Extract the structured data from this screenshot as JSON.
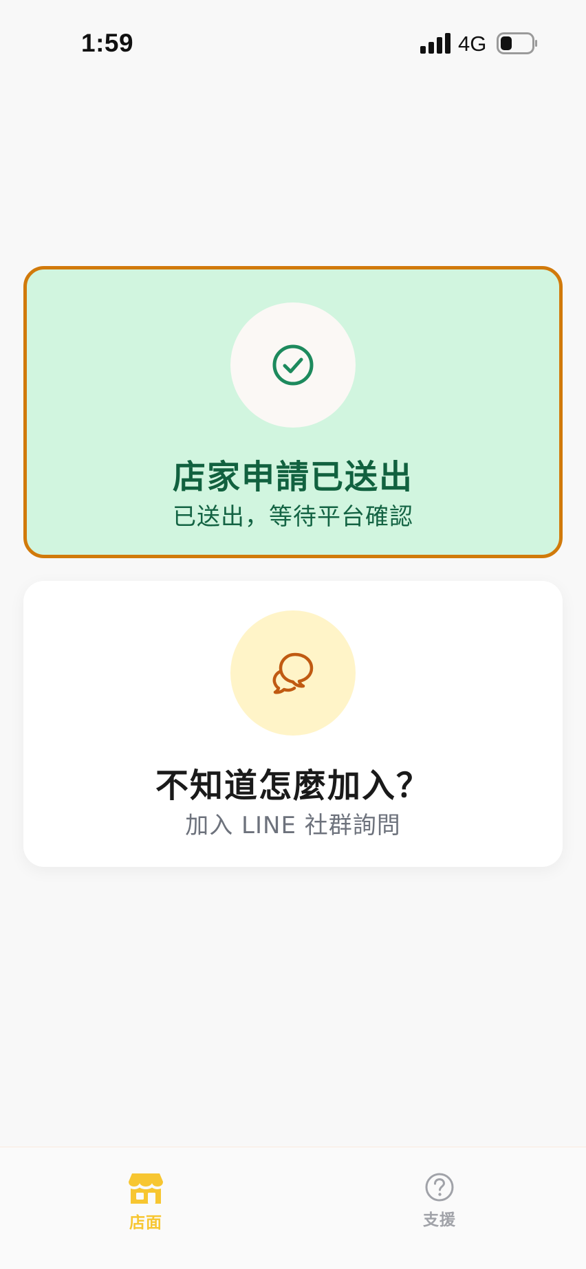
{
  "status_bar": {
    "time": "1:59",
    "network": "4G",
    "signal_icon": "cellular-signal-icon",
    "battery_icon": "battery-icon"
  },
  "status_card": {
    "icon": "check-circle-icon",
    "title": "店家申請已送出",
    "subtitle": "已送出，等待平台確認",
    "background_color": "#d1f5df",
    "border_color": "#d17a0b",
    "icon_color": "#1d8a5d"
  },
  "help_card": {
    "icon": "chat-bubbles-icon",
    "title": "不知道怎麼加入？",
    "subtitle": "加入 LINE 社群詢問",
    "icon_color": "#c05a12",
    "icon_background": "#fff4c8"
  },
  "bottom_nav": {
    "items": [
      {
        "label": "店面",
        "icon": "storefront-icon",
        "active": true,
        "color": "#f7c631"
      },
      {
        "label": "支援",
        "icon": "help-circle-icon",
        "active": false,
        "color": "#a0a2a8"
      }
    ]
  }
}
